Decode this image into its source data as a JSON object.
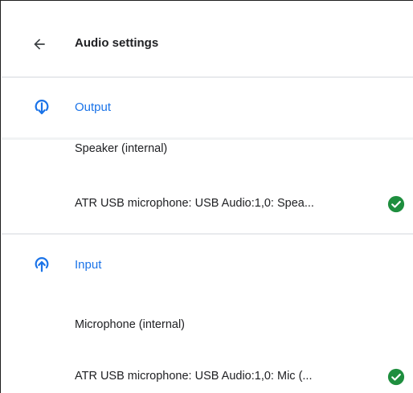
{
  "header": {
    "title": "Audio settings",
    "back_icon": "arrow-left-icon"
  },
  "output": {
    "label": "Output",
    "icon": "output-arrow-icon",
    "devices": [
      {
        "label": "Speaker (internal)",
        "selected": false
      },
      {
        "label": "ATR USB microphone: USB Audio:1,0: Spea...",
        "selected": true
      }
    ]
  },
  "input": {
    "label": "Input",
    "icon": "input-arrow-icon",
    "devices": [
      {
        "label": "Microphone (internal)",
        "selected": false
      },
      {
        "label": "ATR USB microphone: USB Audio:1,0: Mic (...",
        "selected": true
      }
    ]
  },
  "colors": {
    "accent": "#1a73e8",
    "check": "#1e8e3e",
    "divider": "#e8eaed"
  }
}
